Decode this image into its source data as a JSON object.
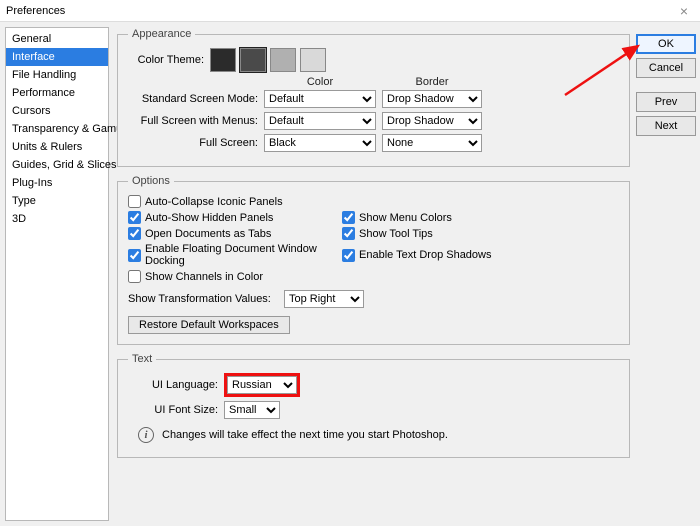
{
  "window": {
    "title": "Preferences"
  },
  "sidebar": {
    "items": [
      "General",
      "Interface",
      "File Handling",
      "Performance",
      "Cursors",
      "Transparency & Gamut",
      "Units & Rulers",
      "Guides, Grid & Slices",
      "Plug-Ins",
      "Type",
      "3D"
    ],
    "selectedIndex": 1
  },
  "buttons": {
    "ok": "OK",
    "cancel": "Cancel",
    "prev": "Prev",
    "next": "Next"
  },
  "appearance": {
    "legend": "Appearance",
    "colorThemeLabel": "Color Theme:",
    "swatches": [
      "#2b2b2b",
      "#4a4a4a",
      "#b0b0b0",
      "#d9d9d9"
    ],
    "selectedSwatch": 1,
    "headerColor": "Color",
    "headerBorder": "Border",
    "rows": [
      {
        "label": "Standard Screen Mode:",
        "color": "Default",
        "border": "Drop Shadow"
      },
      {
        "label": "Full Screen with Menus:",
        "color": "Default",
        "border": "Drop Shadow"
      },
      {
        "label": "Full Screen:",
        "color": "Black",
        "border": "None"
      }
    ]
  },
  "options": {
    "legend": "Options",
    "checks": {
      "autoCollapse": {
        "label": "Auto-Collapse Iconic Panels",
        "checked": false
      },
      "autoShow": {
        "label": "Auto-Show Hidden Panels",
        "checked": true
      },
      "openTabs": {
        "label": "Open Documents as Tabs",
        "checked": true
      },
      "docking": {
        "label": "Enable Floating Document Window Docking",
        "checked": true
      },
      "channels": {
        "label": "Show Channels in Color",
        "checked": false
      },
      "menuColors": {
        "label": "Show Menu Colors",
        "checked": true
      },
      "toolTips": {
        "label": "Show Tool Tips",
        "checked": true
      },
      "textShadows": {
        "label": "Enable Text Drop Shadows",
        "checked": true
      }
    },
    "transformLabel": "Show Transformation Values:",
    "transformValue": "Top Right",
    "restore": "Restore Default Workspaces"
  },
  "text": {
    "legend": "Text",
    "uiLanguageLabel": "UI Language:",
    "uiLanguageValue": "Russian",
    "uiFontSizeLabel": "UI Font Size:",
    "uiFontSizeValue": "Small",
    "info": "Changes will take effect the next time you start Photoshop."
  }
}
